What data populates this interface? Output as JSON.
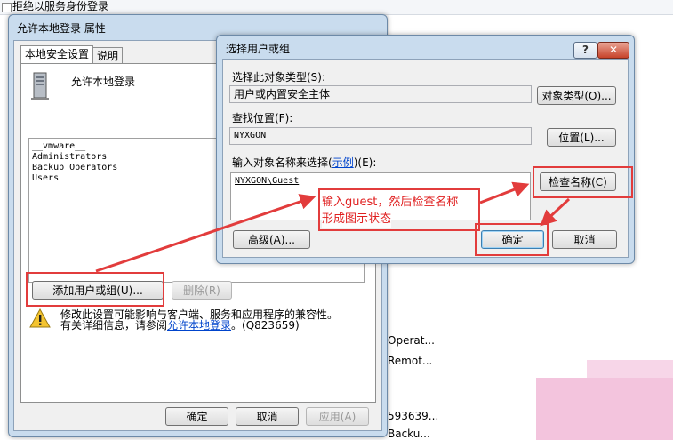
{
  "background_window": {
    "title": "拒绝以服务身份登录",
    "list_items": [
      "Operat...",
      "Remot...",
      "593639...",
      "Backu..."
    ]
  },
  "properties_dialog": {
    "title": "允许本地登录 属性",
    "tabs": [
      {
        "label": "本地安全设置",
        "active": true
      },
      {
        "label": "说明",
        "active": false
      }
    ],
    "policy_name": "允许本地登录",
    "members": [
      "__vmware__",
      "Administrators",
      "Backup Operators",
      "Users"
    ],
    "add_button": "添加用户或组(U)...",
    "remove_button": "删除(R)",
    "warning_line1": "修改此设置可能影响与客户端、服务和应用程序的兼容性。",
    "warning_line2_prefix": "有关详细信息，请参阅",
    "warning_link": "允许本地登录",
    "warning_suffix": "。(Q823659)",
    "ok_button": "确定",
    "cancel_button": "取消",
    "apply_button": "应用(A)"
  },
  "select_dialog": {
    "title": "选择用户或组",
    "help_button": "?",
    "close_button": "✕",
    "object_type_label": "选择此对象类型(S):",
    "object_type_value": "用户或内置安全主体",
    "object_types_button": "对象类型(O)...",
    "location_label": "查找位置(F):",
    "location_value": "NYXGON",
    "locations_button": "位置(L)...",
    "enter_names_label_prefix": "输入对象名称来选择(",
    "enter_names_link": "示例",
    "enter_names_label_suffix": ")(E):",
    "names_value": "NYXGON\\Guest",
    "check_names_button": "检查名称(C)",
    "advanced_button": "高级(A)...",
    "ok_button": "确定",
    "cancel_button": "取消"
  },
  "annotation": {
    "line1": "输入guest，然后检查名称",
    "line2": "形成图示状态",
    "color": "#e23c3c"
  }
}
